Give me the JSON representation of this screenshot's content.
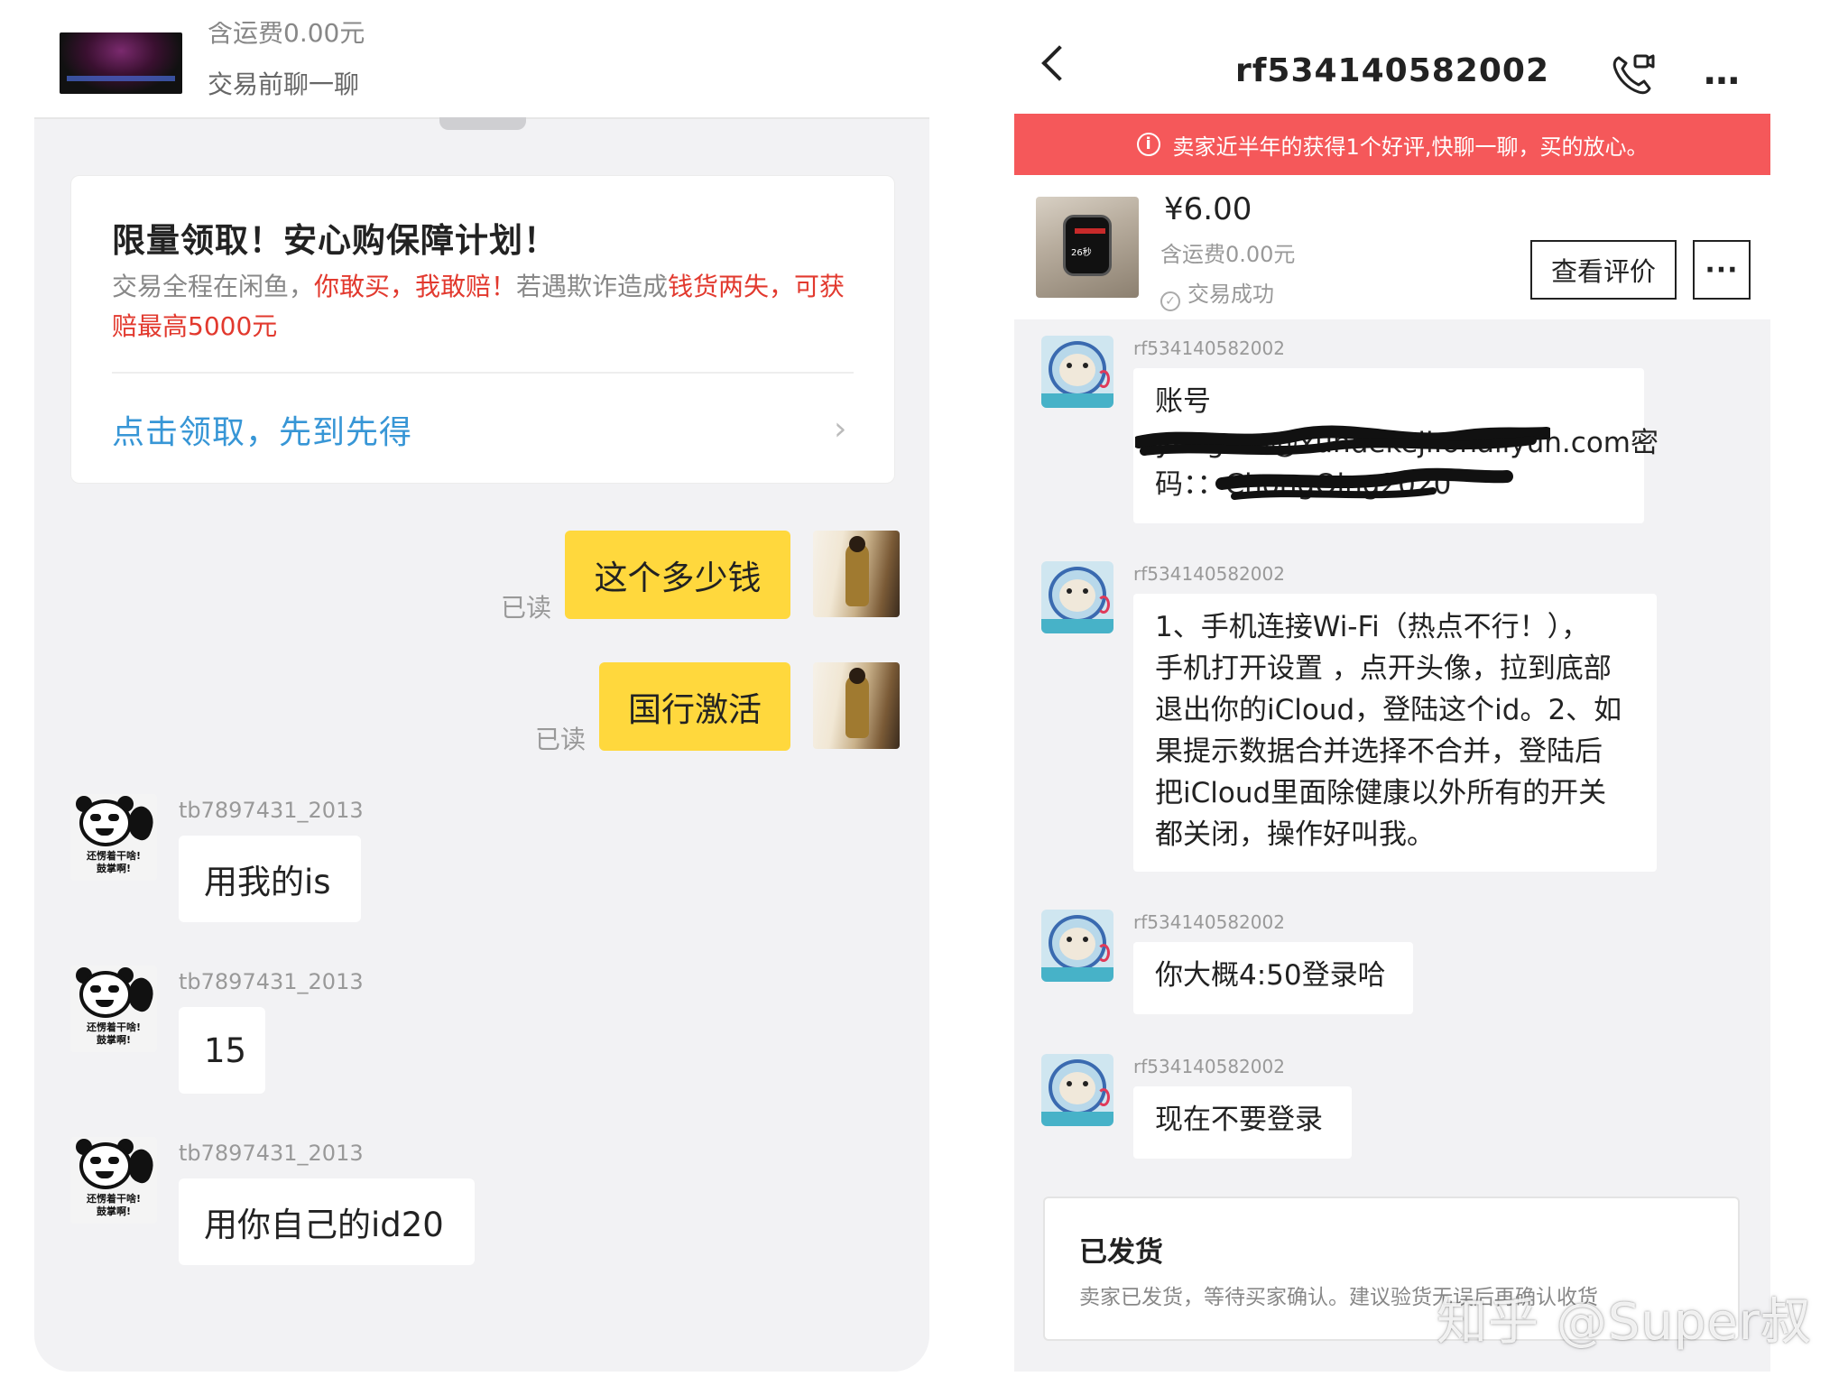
{
  "left": {
    "top": {
      "shipping_partial": "含运费0.00元",
      "chat_before_trade": "交易前聊一聊"
    },
    "promo": {
      "title": "限量领取！安心购保障计划！",
      "body_1": "交易全程在闲鱼，",
      "body_2": "你敢买，我敢赔！",
      "body_3": "若遇欺诈造成",
      "body_4": "钱货两失，可获赔最高5000元",
      "link": "点击领取，先到先得",
      "chevron": "›"
    },
    "read_label": "已读",
    "my_messages": [
      {
        "text": "这个多少钱",
        "status": "已读"
      },
      {
        "text": "国行激活",
        "status": "已读"
      }
    ],
    "panda_caption": "还愣着干啥!\n鼓掌啊!",
    "buyer_messages": [
      {
        "user": "tb7897431_2013",
        "text": "用我的is"
      },
      {
        "user": "tb7897431_2013",
        "text": "15"
      },
      {
        "user": "tb7897431_2013",
        "text": "用你自己的id20"
      }
    ]
  },
  "right": {
    "header": {
      "title": "rf534140582002",
      "back_icon": "chevron-left-icon",
      "call_icon": "phone-icon",
      "more_icon": "…"
    },
    "notice": {
      "icon": "i",
      "text": "卖家近半年的获得1个好评,快聊一聊，买的放心。"
    },
    "order": {
      "price": "¥6.00",
      "shipping": "含运费0.00元",
      "status": "交易成功",
      "thumb_text": "26秒",
      "review_button": "查看评价",
      "more_button": "···"
    },
    "messages": [
      {
        "user": "rf534140582002",
        "lines": [
          "账号",
          "yangran@xundekeji.onaliyun.com密",
          "码：：ChongQing2020"
        ]
      },
      {
        "user": "rf534140582002",
        "lines": [
          "1、手机连接Wi-Fi（热点不行！），",
          "手机打开设置 ，点开头像，拉到底部",
          "退出你的iCloud，登陆这个id。2、如",
          "果提示数据合并选择不合并，登陆后",
          "把iCloud里面除健康以外所有的开关",
          "都关闭，操作好叫我。"
        ]
      },
      {
        "user": "rf534140582002",
        "lines": [
          "你大概4:50登录哈"
        ]
      },
      {
        "user": "rf534140582002",
        "lines": [
          "现在不要登录"
        ]
      }
    ],
    "shipped": {
      "title": "已发货",
      "desc": "卖家已发货，等待买家确认。建议验货无误后再确认收货"
    }
  },
  "watermark": "知乎 @Super叔",
  "colors": {
    "accent_yellow": "#ffd83d",
    "alert_red": "#f5585a",
    "link_blue": "#3796d6",
    "promo_red": "#e2392e"
  }
}
